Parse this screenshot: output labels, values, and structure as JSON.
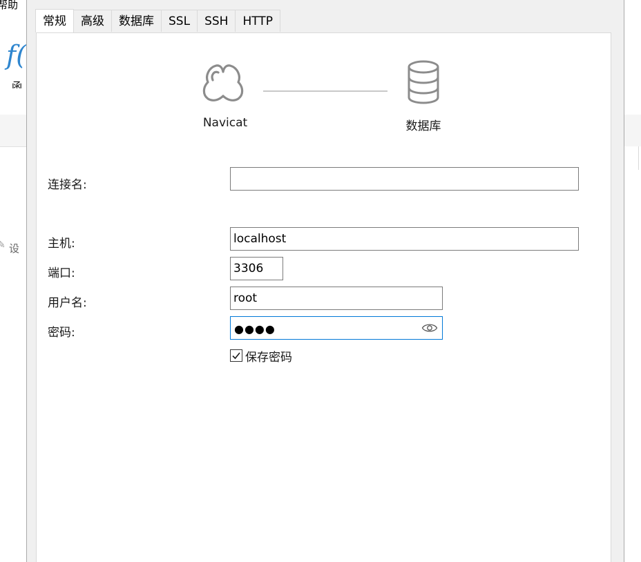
{
  "background": {
    "menu_help": "帮助",
    "ribbon_function_label": "函",
    "toolbar_design_label": "设"
  },
  "dialog": {
    "tabs": [
      {
        "label": "常规",
        "active": true
      },
      {
        "label": "高级",
        "active": false
      },
      {
        "label": "数据库",
        "active": false
      },
      {
        "label": "SSL",
        "active": false
      },
      {
        "label": "SSH",
        "active": false
      },
      {
        "label": "HTTP",
        "active": false
      }
    ],
    "diagram": {
      "left_label": "Navicat",
      "right_label": "数据库",
      "left_icon": "navicat-logo-icon",
      "right_icon": "database-icon"
    },
    "form": {
      "connection_name": {
        "label": "连接名:",
        "value": ""
      },
      "host": {
        "label": "主机:",
        "value": "localhost"
      },
      "port": {
        "label": "端口:",
        "value": "3306"
      },
      "username": {
        "label": "用户名:",
        "value": "root"
      },
      "password": {
        "label": "密码:",
        "masked": "●●●●"
      },
      "save_password": {
        "label": "保存密码",
        "checked": true
      }
    }
  },
  "colors": {
    "focus_border": "#0078d7",
    "icon_gray": "#8c8c8c",
    "accent_fx": "#2f86cf"
  }
}
